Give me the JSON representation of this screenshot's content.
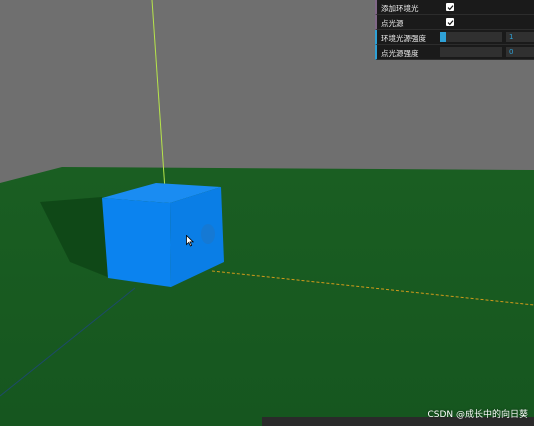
{
  "gui": {
    "controls": [
      {
        "label": "添加环境光",
        "type": "checkbox",
        "checked": true
      },
      {
        "label": "点光源",
        "type": "checkbox",
        "checked": true
      },
      {
        "label": "环境光源强度",
        "type": "slider",
        "value": "1",
        "fill_fraction": 0.1
      },
      {
        "label": "点光源强度",
        "type": "slider",
        "value": "0",
        "fill_fraction": 0.0
      }
    ]
  },
  "watermark": "CSDN @成长中的向日葵",
  "colors": {
    "background": "#6f6f6f",
    "floor": "#175a20",
    "cube": "#0c86f0",
    "light_line": "#b6e44a",
    "gui_bg": "#1a1a1a",
    "slider_accent": "#2fa1d6"
  }
}
